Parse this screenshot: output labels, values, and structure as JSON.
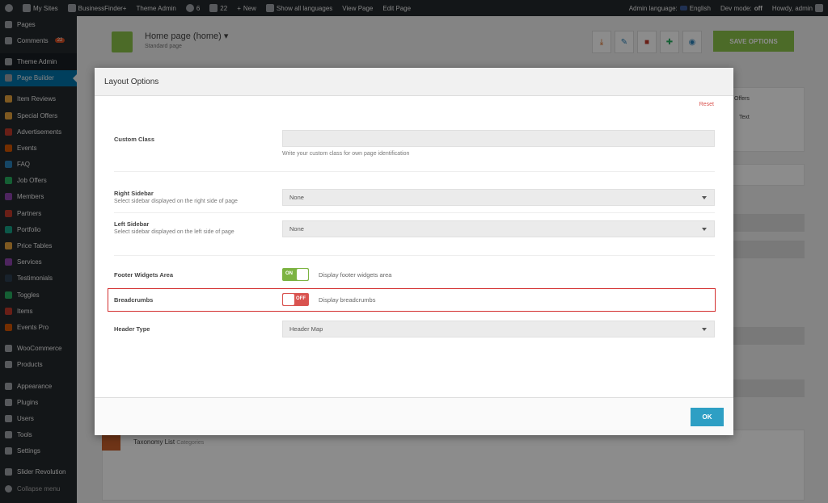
{
  "adminbar": {
    "my_sites": "My Sites",
    "site_name": "BusinessFinder+",
    "theme_admin": "Theme Admin",
    "updates_count": "6",
    "comments_count": "22",
    "new_label": "New",
    "languages": "Show all languages",
    "view_page": "View Page",
    "edit_page": "Edit Page",
    "admin_language": "Admin language:",
    "language": "English",
    "dev_mode_label": "Dev mode:",
    "dev_mode_value": "off",
    "howdy": "Howdy, admin"
  },
  "sidebar": {
    "items": [
      {
        "label": "Pages",
        "icon": "pages-icon"
      },
      {
        "label": "Comments",
        "icon": "comments-icon",
        "badge": "22"
      },
      {
        "label": "Theme Admin",
        "icon": "theme-admin-icon"
      },
      {
        "label": "Page Builder",
        "icon": "page-builder-icon"
      },
      {
        "label": "Item Reviews",
        "icon": "reviews-icon"
      },
      {
        "label": "Special Offers",
        "icon": "offers-icon"
      },
      {
        "label": "Advertisements",
        "icon": "ads-icon"
      },
      {
        "label": "Events",
        "icon": "events-icon"
      },
      {
        "label": "FAQ",
        "icon": "faq-icon"
      },
      {
        "label": "Job Offers",
        "icon": "jobs-icon"
      },
      {
        "label": "Members",
        "icon": "members-icon"
      },
      {
        "label": "Partners",
        "icon": "partners-icon"
      },
      {
        "label": "Portfolio",
        "icon": "portfolio-icon"
      },
      {
        "label": "Price Tables",
        "icon": "price-tables-icon"
      },
      {
        "label": "Services",
        "icon": "services-icon"
      },
      {
        "label": "Testimonials",
        "icon": "testimonials-icon"
      },
      {
        "label": "Toggles",
        "icon": "toggles-icon"
      },
      {
        "label": "Items",
        "icon": "items-icon"
      },
      {
        "label": "Events Pro",
        "icon": "events-pro-icon"
      },
      {
        "label": "WooCommerce",
        "icon": "woocommerce-icon"
      },
      {
        "label": "Products",
        "icon": "products-icon"
      },
      {
        "label": "Appearance",
        "icon": "appearance-icon"
      },
      {
        "label": "Plugins",
        "icon": "plugins-icon"
      },
      {
        "label": "Users",
        "icon": "users-icon"
      },
      {
        "label": "Tools",
        "icon": "tools-icon"
      },
      {
        "label": "Settings",
        "icon": "settings-icon"
      },
      {
        "label": "Slider Revolution",
        "icon": "slider-icon"
      },
      {
        "label": "Collapse menu",
        "icon": "collapse-icon"
      }
    ]
  },
  "page": {
    "title": "Home page (home)",
    "subtitle": "Standard page",
    "save_label": "SAVE OPTIONS",
    "tag_offers": "Offers",
    "tag_text": "Text",
    "taxonomy_label": "Taxonomy List",
    "taxonomy_sub": "Categories"
  },
  "modal": {
    "title": "Layout Options",
    "reset": "Reset",
    "custom_class": {
      "label": "Custom Class",
      "value": "",
      "help": "Write your custom class for own page identification"
    },
    "right_sidebar": {
      "label": "Right Sidebar",
      "desc": "Select sidebar displayed on the right side of page",
      "value": "None"
    },
    "left_sidebar": {
      "label": "Left Sidebar",
      "desc": "Select sidebar displayed on the left side of page",
      "value": "None"
    },
    "footer_widgets": {
      "label": "Footer Widgets Area",
      "state": "ON",
      "desc": "Display footer widgets area"
    },
    "breadcrumbs": {
      "label": "Breadcrumbs",
      "state": "OFF",
      "desc": "Display breadcrumbs"
    },
    "header_type": {
      "label": "Header Type",
      "value": "Header Map"
    },
    "ok": "OK"
  },
  "colors": {
    "accent": "#0073aa",
    "save": "#8bc34a",
    "toggle_on": "#7cb342",
    "toggle_off": "#d9534f",
    "ok": "#2e9fc4"
  }
}
